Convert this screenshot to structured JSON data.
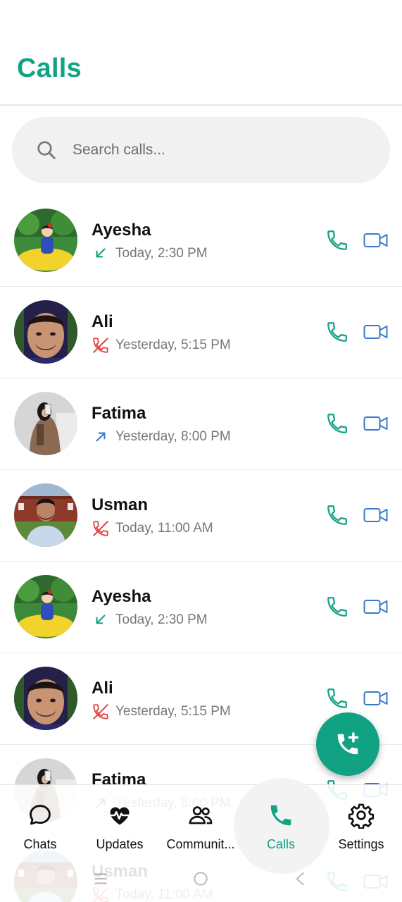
{
  "header": {
    "title": "Calls"
  },
  "search": {
    "placeholder": "Search calls..."
  },
  "calls": [
    {
      "name": "Ayesha",
      "time": "Today, 2:30 PM",
      "direction": "incoming",
      "avatar": "cartoon-princess"
    },
    {
      "name": "Ali",
      "time": "Yesterday, 5:15 PM",
      "direction": "missed",
      "avatar": "man-portrait"
    },
    {
      "name": "Fatima",
      "time": "Yesterday, 8:00 PM",
      "direction": "outgoing",
      "avatar": "woman-hijab"
    },
    {
      "name": "Usman",
      "time": "Today, 11:00 AM",
      "direction": "missed",
      "avatar": "man-outdoor"
    },
    {
      "name": "Ayesha",
      "time": "Today, 2:30 PM",
      "direction": "incoming",
      "avatar": "cartoon-princess"
    },
    {
      "name": "Ali",
      "time": "Yesterday, 5:15 PM",
      "direction": "missed",
      "avatar": "man-portrait"
    },
    {
      "name": "Fatima",
      "time": "Yesterday, 8:00 PM",
      "direction": "outgoing",
      "avatar": "woman-hijab"
    },
    {
      "name": "Usman",
      "time": "Today, 11:00 AM",
      "direction": "missed",
      "avatar": "man-outdoor"
    }
  ],
  "fab": {
    "icon": "add-call-icon"
  },
  "nav": {
    "items": [
      {
        "label": "Chats",
        "icon": "chat-bubble-icon"
      },
      {
        "label": "Updates",
        "icon": "heartbeat-icon"
      },
      {
        "label": "Communit...",
        "icon": "people-icon"
      },
      {
        "label": "Calls",
        "icon": "phone-icon",
        "active": true
      },
      {
        "label": "Settings",
        "icon": "gear-icon"
      }
    ]
  },
  "colors": {
    "accent": "#13a384",
    "missed": "#e0443e",
    "outgoing": "#3a7bd5",
    "video": "#3a78c9"
  }
}
